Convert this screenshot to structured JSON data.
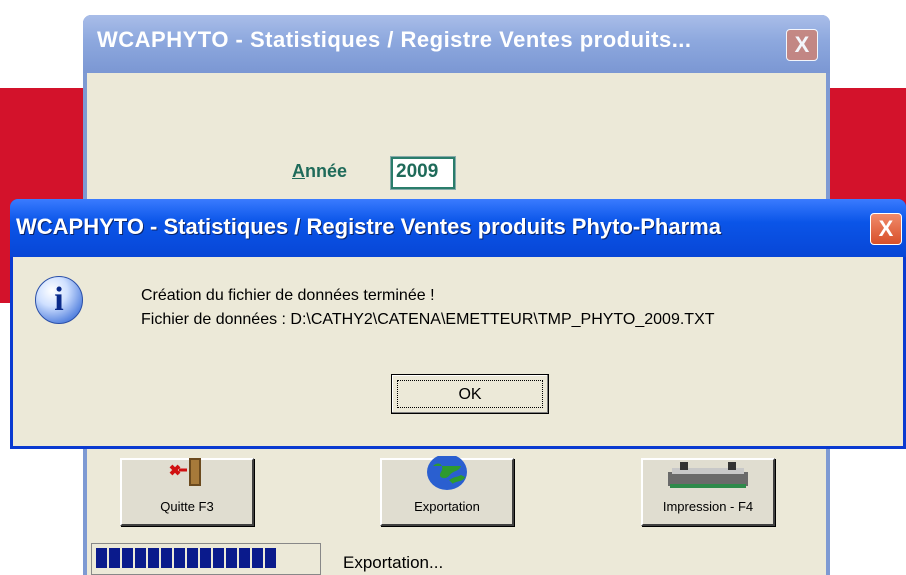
{
  "background_window": {
    "title": "WCAPHYTO - Statistiques / Registre Ventes produits...",
    "close_label": "X",
    "year_label_accel": "A",
    "year_label_rest": "nnée",
    "year_value": "2009",
    "buttons": [
      {
        "label": "Quitte F3",
        "icon": "exit-door-icon"
      },
      {
        "label": "Exportation",
        "icon": "globe-icon"
      },
      {
        "label": "Impression - F4",
        "icon": "printer-icon"
      }
    ],
    "progress_text": "Exportation...",
    "progress_segments": 14
  },
  "dialog": {
    "title": "WCAPHYTO - Statistiques / Registre Ventes produits Phyto-Pharma",
    "close_label": "X",
    "icon": "info-icon",
    "message_line1": "Création du fichier de données terminée !",
    "message_line2": "Fichier de données : D:\\CATHY2\\CATENA\\EMETTEUR\\TMP_PHYTO_2009.TXT",
    "ok_label": "OK"
  },
  "colors": {
    "background_band": "#d3122b",
    "dialog_titlebar": "#0a55e8",
    "window_face": "#ece9d8",
    "progress": "#0a1a8c"
  }
}
